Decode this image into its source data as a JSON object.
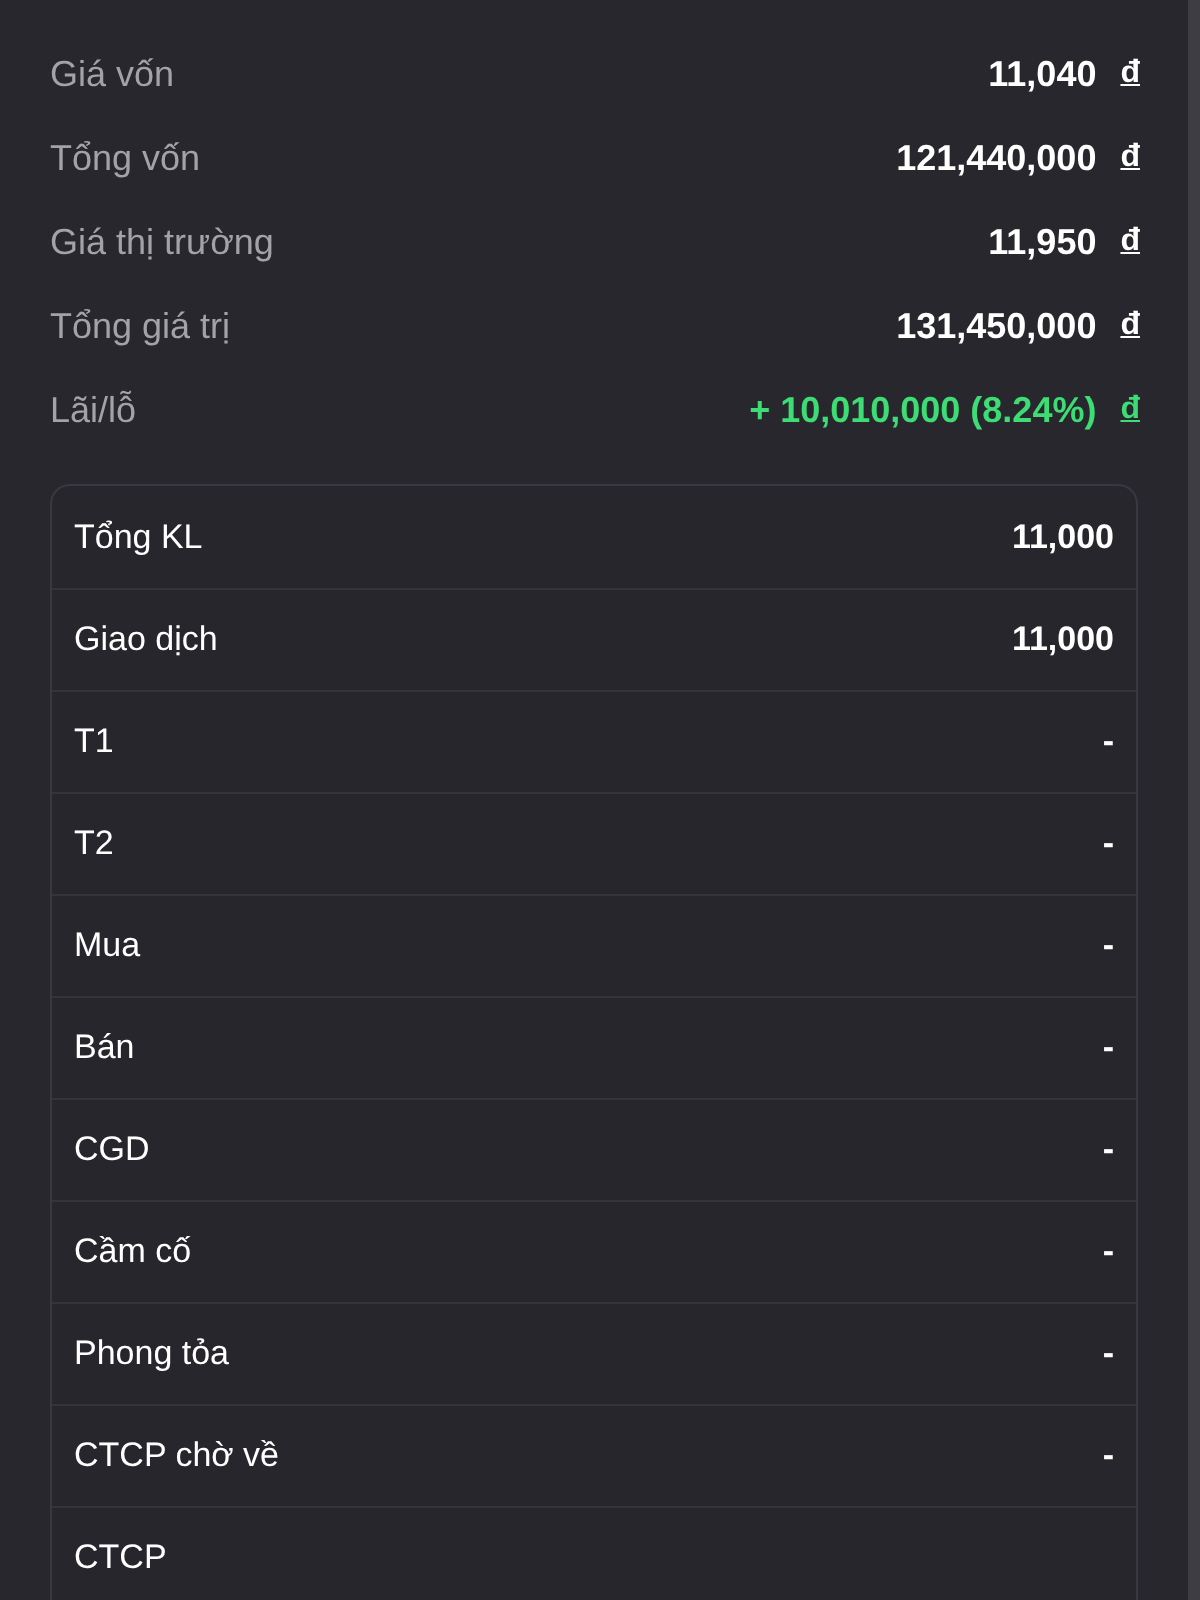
{
  "summary": [
    {
      "label": "Giá vốn",
      "value": "11,040",
      "currency": "đ",
      "kind": "plain"
    },
    {
      "label": "Tổng vốn",
      "value": "121,440,000",
      "currency": "đ",
      "kind": "plain"
    },
    {
      "label": "Giá thị trường",
      "value": "11,950",
      "currency": "đ",
      "kind": "plain"
    },
    {
      "label": "Tổng giá trị",
      "value": "131,450,000",
      "currency": "đ",
      "kind": "plain"
    },
    {
      "label": "Lãi/lỗ",
      "value": "+ 10,010,000 (8.24%)",
      "currency": "đ",
      "kind": "gain"
    }
  ],
  "details": [
    {
      "label": "Tổng KL",
      "value": "11,000"
    },
    {
      "label": "Giao dịch",
      "value": "11,000"
    },
    {
      "label": "T1",
      "value": "-"
    },
    {
      "label": "T2",
      "value": "-"
    },
    {
      "label": "Mua",
      "value": "-"
    },
    {
      "label": "Bán",
      "value": "-"
    },
    {
      "label": "CGD",
      "value": "-"
    },
    {
      "label": "Cầm cố",
      "value": "-"
    },
    {
      "label": "Phong tỏa",
      "value": "-"
    },
    {
      "label": "CTCP chờ về",
      "value": "-"
    },
    {
      "label": "CTCP"
    }
  ]
}
